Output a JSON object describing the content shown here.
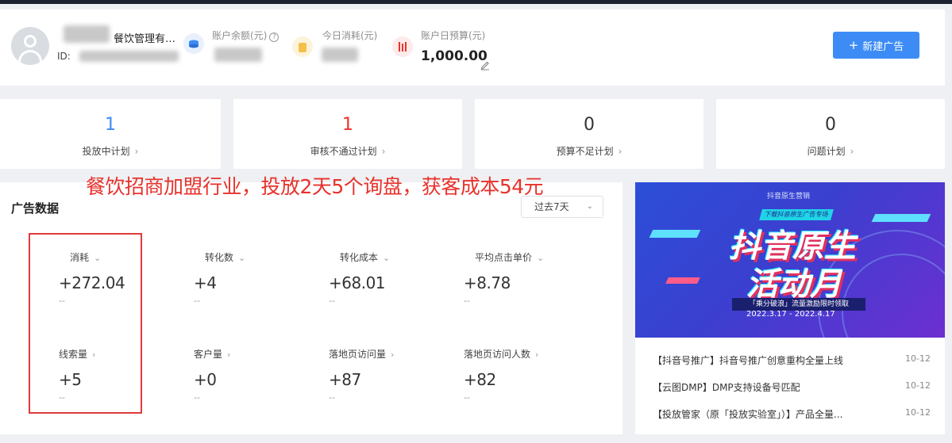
{
  "account": {
    "name": "餐饮管理有…",
    "id_label": "ID:",
    "balance_label": "账户余额(元)",
    "today_spend_label": "今日消耗(元)",
    "daily_budget_label": "账户日预算(元)",
    "daily_budget_value": "1,000.00"
  },
  "actions": {
    "new_ad_label": "新建广告"
  },
  "plans": [
    {
      "count": "1",
      "label": "投放中计划",
      "color": "#3d8cf5"
    },
    {
      "count": "1",
      "label": "审核不通过计划",
      "color": "#e8322c"
    },
    {
      "count": "0",
      "label": "预算不足计划",
      "color": "#333333"
    },
    {
      "count": "0",
      "label": "问题计划",
      "color": "#333333"
    }
  ],
  "overlay_caption": "餐饮招商加盟行业，投放2天5个询盘，获客成本54元",
  "ad_data": {
    "title": "广告数据",
    "range": "过去7天",
    "metrics": [
      {
        "label": "消耗",
        "value": "+272.04",
        "sub": "--"
      },
      {
        "label": "转化数",
        "value": "+4",
        "sub": "--"
      },
      {
        "label": "转化成本",
        "value": "+68.01",
        "sub": "--"
      },
      {
        "label": "平均点击单价",
        "value": "+8.78",
        "sub": "--"
      },
      {
        "label": "线索量",
        "value": "+5",
        "sub": "--"
      },
      {
        "label": "客户量",
        "value": "+0",
        "sub": "--"
      },
      {
        "label": "落地页访问量",
        "value": "+87",
        "sub": "--"
      },
      {
        "label": "落地页访问人数",
        "value": "+82",
        "sub": "--"
      }
    ]
  },
  "banner": {
    "brand": "抖音原生营销",
    "tag": "下载抖音原生广告专场",
    "headline_1": "抖音原生",
    "headline_2": "活动月",
    "promo": "「乘分破浪」流量激励限时领取",
    "dates": "2022.3.17 - 2022.4.17"
  },
  "news": [
    {
      "text": "【抖音号推广】抖音号推广创意重构全量上线",
      "date": "10-12"
    },
    {
      "text": "【云图DMP】DMP支持设备号匹配",
      "date": "10-12"
    },
    {
      "text": "【投放管家（原「投放实验室」）】产品全量...",
      "date": "10-12"
    }
  ],
  "colors": {
    "accent": "#3d8cf5",
    "alert": "#e8322c",
    "highlight_box": "#e03a3a"
  }
}
